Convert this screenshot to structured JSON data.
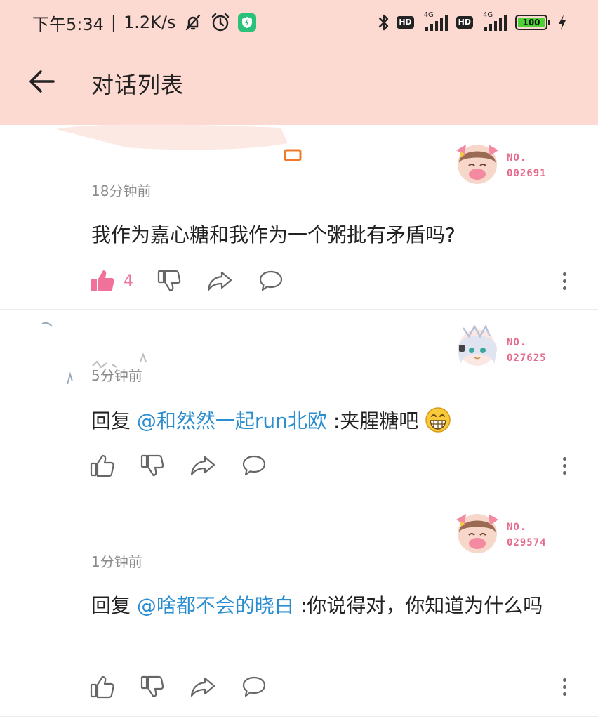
{
  "status_bar": {
    "time": "下午5:34",
    "net_speed": "1.2K/s",
    "hd_label": "HD",
    "network_label": "4G",
    "battery": "100"
  },
  "header": {
    "title": "对话列表"
  },
  "comments": [
    {
      "fan_no_label": "NO.",
      "fan_no": "002691",
      "time": "18分钟前",
      "text": "我作为嘉心糖和我作为一个粥批有矛盾吗?",
      "like_count": "4",
      "liked": true
    },
    {
      "fan_no_label": "NO.",
      "fan_no": "027625",
      "time": "5分钟前",
      "reply_prefix": "回复",
      "mention": "@和然然一起run北欧",
      "text": ":夹腥糖吧",
      "liked": false
    },
    {
      "fan_no_label": "NO.",
      "fan_no": "029574",
      "time": "1分钟前",
      "reply_prefix": "回复",
      "mention": "@啥都不会的晓白",
      "text": ":你说得对，你知道为什么吗",
      "liked": false
    }
  ],
  "colors": {
    "header_bg": "#fcd9d1",
    "like_active": "#f0719a",
    "mention": "#2a8ed1",
    "fan_no": "#e66b8d"
  }
}
